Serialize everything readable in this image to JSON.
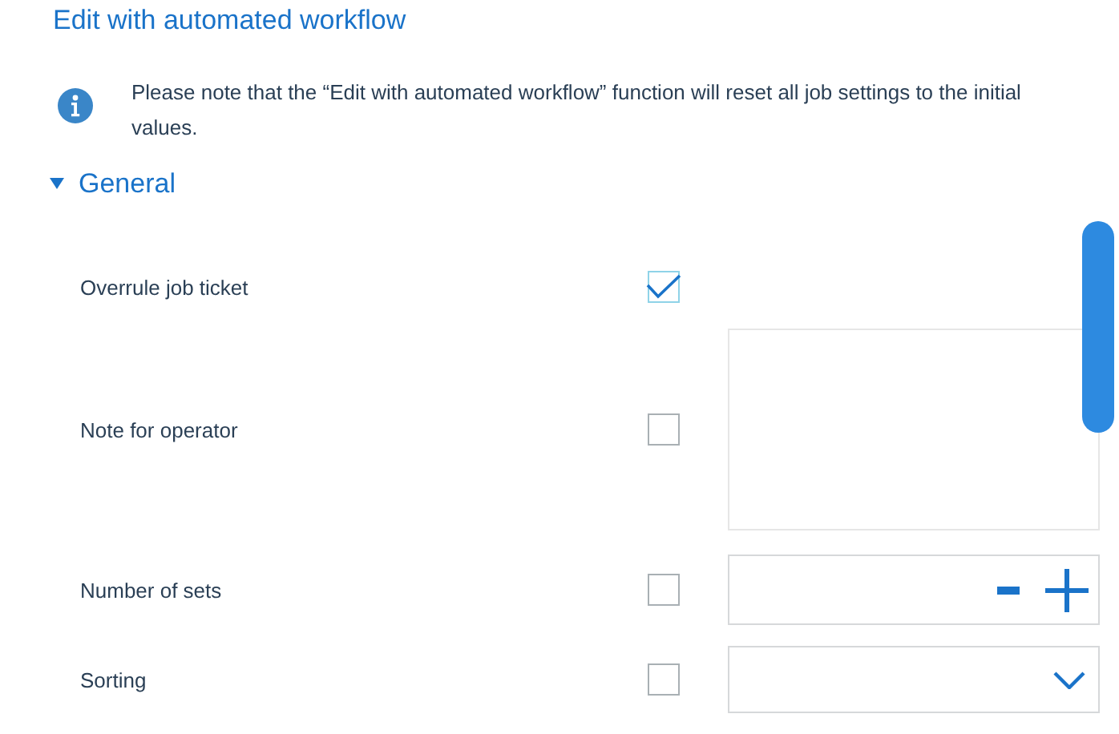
{
  "title": "Edit with automated workflow",
  "notice": "Please note that the “Edit with automated workflow” function will reset all job settings to the initial values.",
  "section": {
    "label": "General",
    "expanded": true
  },
  "rows": [
    {
      "label": "Overrule job ticket",
      "checked": true,
      "kind": "plain"
    },
    {
      "label": "Note for operator",
      "checked": false,
      "kind": "textarea"
    },
    {
      "label": "Number of sets",
      "checked": false,
      "kind": "stepper"
    },
    {
      "label": "Sorting",
      "checked": false,
      "kind": "dropdown"
    }
  ]
}
